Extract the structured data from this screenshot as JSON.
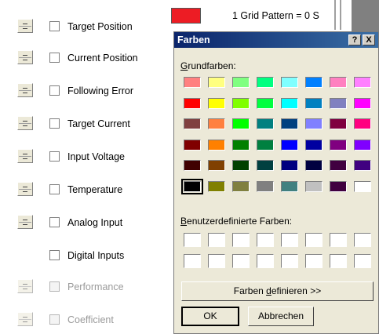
{
  "channels": [
    {
      "label": "Target Position",
      "enabled": true,
      "has_spin": true
    },
    {
      "label": "Current Position",
      "enabled": true,
      "has_spin": true
    },
    {
      "label": "Following Error",
      "enabled": true,
      "has_spin": true
    },
    {
      "label": "Target Current",
      "enabled": true,
      "has_spin": true
    },
    {
      "label": "Input Voltage",
      "enabled": true,
      "has_spin": true
    },
    {
      "label": "Temperature",
      "enabled": true,
      "has_spin": true
    },
    {
      "label": "Analog Input",
      "enabled": true,
      "has_spin": true
    },
    {
      "label": "Digital Inputs",
      "enabled": true,
      "has_spin": false
    },
    {
      "label": "Performance",
      "enabled": false,
      "has_spin": true
    },
    {
      "label": "Coefficient",
      "enabled": false,
      "has_spin": true
    }
  ],
  "toolbar": {
    "selected_color": "#ed1c24",
    "grid_pattern": "1 Grid Pattern = 0 S"
  },
  "dialog": {
    "title": "Farben",
    "help_label": "?",
    "close_label": "X",
    "basic_colors_label": "Grundfarben:",
    "custom_colors_label": "Benutzerdefinierte Farben:",
    "define_colors_label": "Farben definieren >>",
    "ok_label": "OK",
    "cancel_label": "Abbrechen",
    "basic_colors": [
      [
        "#ff8080",
        "#ffff80",
        "#80ff80",
        "#00ff80",
        "#80ffff",
        "#0080ff",
        "#ff80c0",
        "#ff80ff"
      ],
      [
        "#ff0000",
        "#ffff00",
        "#80ff00",
        "#00ff40",
        "#00ffff",
        "#0080c0",
        "#8080c0",
        "#ff00ff"
      ],
      [
        "#804040",
        "#ff8040",
        "#00ff00",
        "#008080",
        "#004080",
        "#8080ff",
        "#800040",
        "#ff0080"
      ],
      [
        "#800000",
        "#ff8000",
        "#008000",
        "#008040",
        "#0000ff",
        "#0000a0",
        "#800080",
        "#8000ff"
      ],
      [
        "#400000",
        "#804000",
        "#004000",
        "#004040",
        "#000080",
        "#000040",
        "#400040",
        "#400080"
      ],
      [
        "#000000",
        "#808000",
        "#808040",
        "#808080",
        "#408080",
        "#c0c0c0",
        "#400040",
        "#ffffff"
      ]
    ],
    "selected_basic_color": "#000000",
    "custom_colors": [
      [
        "#ffffff",
        "#ffffff",
        "#ffffff",
        "#ffffff",
        "#ffffff",
        "#ffffff",
        "#ffffff",
        "#ffffff"
      ],
      [
        "#ffffff",
        "#ffffff",
        "#ffffff",
        "#ffffff",
        "#ffffff",
        "#ffffff",
        "#ffffff",
        "#ffffff"
      ]
    ]
  }
}
